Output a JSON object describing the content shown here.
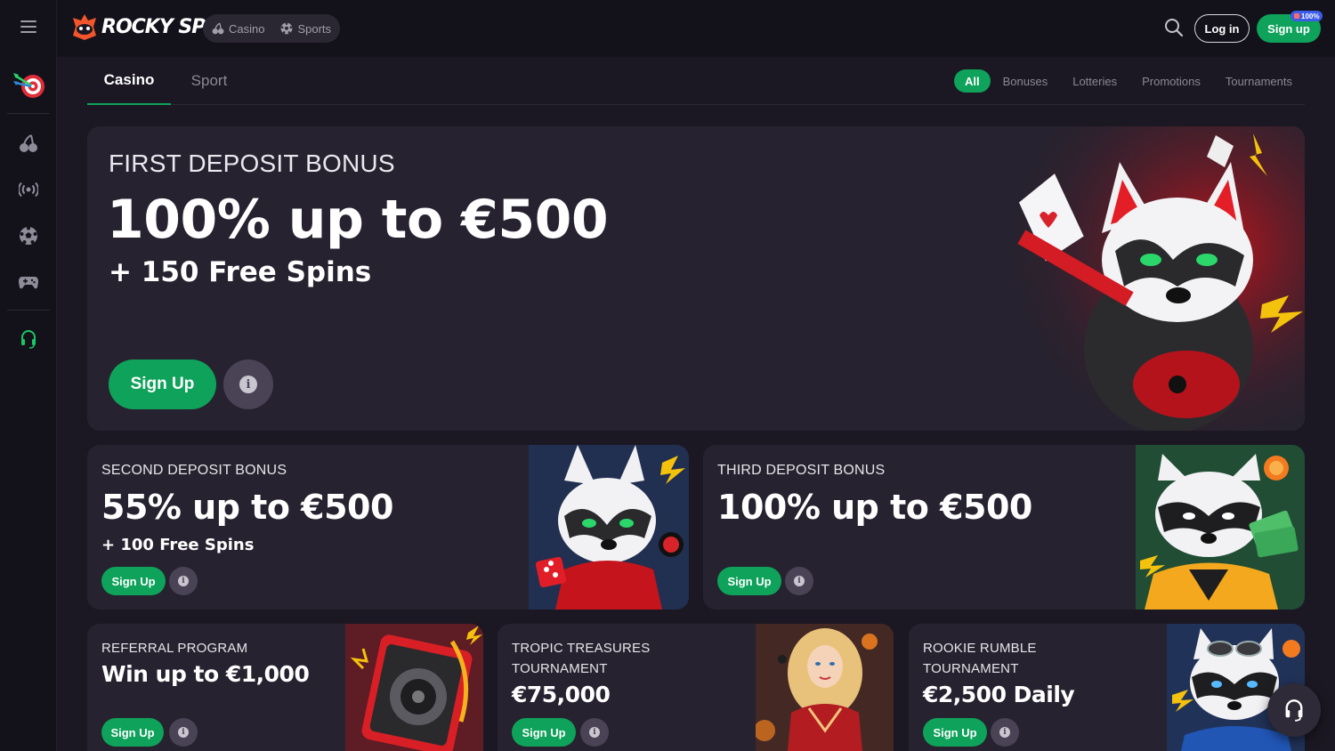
{
  "header": {
    "logo_text": "ROCKY SPIN",
    "switch": [
      {
        "label": "Casino",
        "icon": "cherries-icon"
      },
      {
        "label": "Sports",
        "icon": "soccer-ball-icon"
      }
    ],
    "login_label": "Log in",
    "signup_label": "Sign up",
    "signup_badge": "100%"
  },
  "sidebar": {
    "items": [
      "menu-icon",
      "target-darts-icon",
      "cherries-icon",
      "live-broadcast-icon",
      "soccer-ball-icon",
      "gamepad-icon",
      "headset-icon"
    ]
  },
  "tabs": [
    {
      "label": "Casino",
      "active": true
    },
    {
      "label": "Sport",
      "active": false
    }
  ],
  "filters": [
    {
      "label": "All",
      "active": true
    },
    {
      "label": "Bonuses",
      "active": false
    },
    {
      "label": "Lotteries",
      "active": false
    },
    {
      "label": "Promotions",
      "active": false
    },
    {
      "label": "Tournaments",
      "active": false
    }
  ],
  "hero": {
    "kicker": "FIRST DEPOSIT BONUS",
    "headline": "100% up to €500",
    "sub": "+ 150 Free Spins",
    "button": "Sign Up"
  },
  "cards": {
    "second": {
      "kicker": "SECOND DEPOSIT BONUS",
      "headline": "55% up to €500",
      "sub": "+ 100 Free Spins",
      "button": "Sign Up"
    },
    "third": {
      "kicker": "THIRD DEPOSIT BONUS",
      "headline": "100% up to €500",
      "button": "Sign Up"
    },
    "referral": {
      "kicker": "REFERRAL PROGRAM",
      "headline": "Win up to €1,000",
      "button": "Sign Up"
    },
    "tropic": {
      "kicker_1": "TROPIC TREASURES",
      "kicker_2": "TOURNAMENT",
      "headline": "€75,000",
      "button": "Sign Up"
    },
    "rookie": {
      "kicker_1": "ROOKIE RUMBLE",
      "kicker_2": "TOURNAMENT",
      "headline": "€2,500 Daily",
      "button": "Sign Up"
    }
  },
  "colors": {
    "accent": "#0ea25a",
    "background": "#1b1823",
    "card": "#26222f",
    "panel": "#13111a"
  }
}
